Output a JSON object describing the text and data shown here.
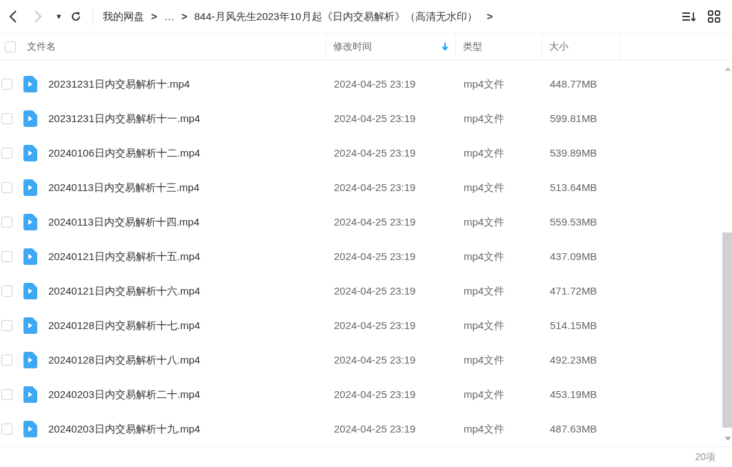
{
  "toolbar": {
    "back": {
      "disabled": false
    },
    "forward": {
      "disabled": true
    },
    "dropdown": "▾",
    "breadcrumb": [
      "我的网盘",
      "…",
      "844-月风先生2023年10月起《日内交易解析》（高清无水印）"
    ],
    "separator": ">"
  },
  "table": {
    "select_all": {
      "checked": false
    },
    "columns": [
      {
        "label": "文件名",
        "sorted": false
      },
      {
        "label": "修改时间",
        "sorted": true
      },
      {
        "label": "类型",
        "sorted": false
      },
      {
        "label": "大小",
        "sorted": false
      }
    ],
    "rows": [
      {
        "name": "20231231日内交易解析十.mp4",
        "modified": "2024-04-25 23:19",
        "type": "mp4文件",
        "size": "448.77MB",
        "checked": false
      },
      {
        "name": "20231231日内交易解析十一.mp4",
        "modified": "2024-04-25 23:19",
        "type": "mp4文件",
        "size": "599.81MB",
        "checked": false
      },
      {
        "name": "20240106日内交易解析十二.mp4",
        "modified": "2024-04-25 23:19",
        "type": "mp4文件",
        "size": "539.89MB",
        "checked": false
      },
      {
        "name": "20240113日内交易解析十三.mp4",
        "modified": "2024-04-25 23:19",
        "type": "mp4文件",
        "size": "513.64MB",
        "checked": false
      },
      {
        "name": "20240113日内交易解析十四.mp4",
        "modified": "2024-04-25 23:19",
        "type": "mp4文件",
        "size": "559.53MB",
        "checked": false
      },
      {
        "name": "20240121日内交易解析十五.mp4",
        "modified": "2024-04-25 23:19",
        "type": "mp4文件",
        "size": "437.09MB",
        "checked": false
      },
      {
        "name": "20240121日内交易解析十六.mp4",
        "modified": "2024-04-25 23:19",
        "type": "mp4文件",
        "size": "471.72MB",
        "checked": false
      },
      {
        "name": "20240128日内交易解析十七.mp4",
        "modified": "2024-04-25 23:19",
        "type": "mp4文件",
        "size": "514.15MB",
        "checked": false
      },
      {
        "name": "20240128日内交易解析十八.mp4",
        "modified": "2024-04-25 23:19",
        "type": "mp4文件",
        "size": "492.23MB",
        "checked": false
      },
      {
        "name": "20240203日内交易解析二十.mp4",
        "modified": "2024-04-25 23:19",
        "type": "mp4文件",
        "size": "453.19MB",
        "checked": false
      },
      {
        "name": "20240203日内交易解析十九.mp4",
        "modified": "2024-04-25 23:19",
        "type": "mp4文件",
        "size": "487.63MB",
        "checked": false
      }
    ]
  },
  "status_bar": {
    "count": "20项"
  }
}
